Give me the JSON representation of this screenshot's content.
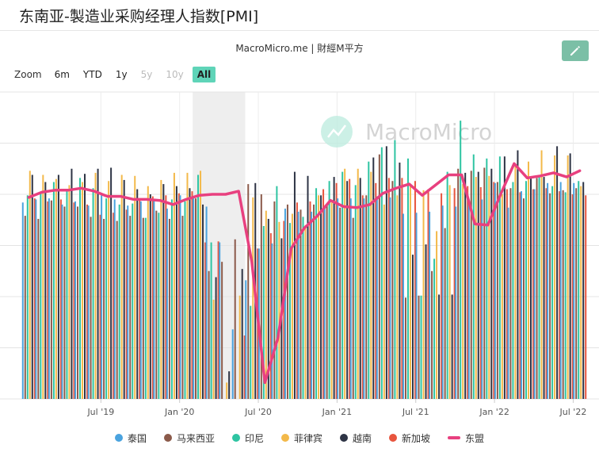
{
  "page": {
    "title": "东南亚-製造业采购经理人指数[PMI]"
  },
  "chart_header": {
    "source": "MacroMicro.me | 財經M平方",
    "watermark": "MacroMicro"
  },
  "zoom": {
    "label": "Zoom",
    "buttons": [
      {
        "label": "6m",
        "state": "normal"
      },
      {
        "label": "YTD",
        "state": "normal"
      },
      {
        "label": "1y",
        "state": "normal"
      },
      {
        "label": "5y",
        "state": "disabled"
      },
      {
        "label": "10y",
        "state": "disabled"
      },
      {
        "label": "All",
        "state": "active"
      }
    ]
  },
  "chart_data": {
    "type": "bar",
    "title": "",
    "xlabel": "",
    "ylabel": "",
    "ylim": [
      30,
      60
    ],
    "x_start": "2019-01",
    "x_end": "2022-08",
    "x_ticks": [
      {
        "label": "Jul '19",
        "date": "2019-07"
      },
      {
        "label": "Jan '20",
        "date": "2020-01"
      },
      {
        "label": "Jul '20",
        "date": "2020-07"
      },
      {
        "label": "Jan '21",
        "date": "2021-01"
      },
      {
        "label": "Jul '21",
        "date": "2021-07"
      },
      {
        "label": "Jan '22",
        "date": "2022-01"
      },
      {
        "label": "Jul '22",
        "date": "2022-07"
      }
    ],
    "recession_band": [
      "2020-02",
      "2020-06"
    ],
    "grid": true,
    "legend_position": "bottom",
    "months": [
      "2019-01",
      "2019-02",
      "2019-03",
      "2019-04",
      "2019-05",
      "2019-06",
      "2019-07",
      "2019-08",
      "2019-09",
      "2019-10",
      "2019-11",
      "2019-12",
      "2020-01",
      "2020-02",
      "2020-03",
      "2020-04",
      "2020-05",
      "2020-06",
      "2020-07",
      "2020-08",
      "2020-09",
      "2020-10",
      "2020-11",
      "2020-12",
      "2021-01",
      "2021-02",
      "2021-03",
      "2021-04",
      "2021-05",
      "2021-06",
      "2021-07",
      "2021-08",
      "2021-09",
      "2021-10",
      "2021-11",
      "2021-12",
      "2022-01",
      "2022-02",
      "2022-03",
      "2022-04",
      "2022-05",
      "2022-06",
      "2022-07"
    ],
    "series": [
      {
        "name": "泰国",
        "type": "bar",
        "color": "#4aa3df",
        "values": [
          49.2,
          49.5,
          49.6,
          49.0,
          49.3,
          48.9,
          49.9,
          49.5,
          48.9,
          49.3,
          49.5,
          48.6,
          49.9,
          49.6,
          48.8,
          45.3,
          36.8,
          41.6,
          44.7,
          45.2,
          48.6,
          48.3,
          48.3,
          48.8,
          49.6,
          49.6,
          49.6,
          49.8,
          49.7,
          48.1,
          48.2,
          48.3,
          48.9,
          48.8,
          49.4,
          49.5,
          51.1,
          48.7,
          50.3,
          50.5,
          51.1,
          51.2,
          51.1
        ]
      },
      {
        "name": "马来西亚",
        "type": "bar",
        "color": "#8b5a4a",
        "values": [
          47.9,
          47.6,
          49.4,
          48.8,
          48.8,
          47.8,
          47.6,
          47.4,
          47.9,
          47.7,
          48.4,
          47.6,
          47.9,
          49.6,
          42.5,
          43.4,
          45.6,
          51.0,
          50.0,
          49.3,
          49.0,
          48.5,
          49.0,
          49.1,
          48.7,
          47.7,
          49.9,
          53.9,
          51.3,
          39.9,
          40.1,
          42.5,
          46.7,
          52.5,
          52.3,
          52.6,
          51.2,
          50.6,
          49.6,
          51.6,
          50.1,
          50.4,
          50.6
        ]
      },
      {
        "name": "印尼",
        "type": "bar",
        "color": "#2ec4a2",
        "values": [
          49.9,
          50.1,
          51.2,
          50.4,
          51.6,
          50.6,
          49.6,
          49.0,
          49.1,
          47.7,
          48.2,
          49.5,
          49.3,
          51.9,
          45.3,
          27.5,
          28.6,
          39.1,
          46.9,
          50.8,
          47.2,
          47.8,
          50.6,
          51.3,
          52.2,
          50.9,
          53.2,
          54.6,
          55.3,
          53.5,
          40.1,
          43.7,
          52.2,
          57.2,
          53.9,
          53.5,
          53.7,
          51.2,
          51.3,
          51.9,
          50.8,
          50.2,
          51.3
        ]
      },
      {
        "name": "菲律宾",
        "type": "bar",
        "color": "#f3b94a",
        "values": [
          52.3,
          51.9,
          51.5,
          50.9,
          51.2,
          52.1,
          51.3,
          51.9,
          51.8,
          50.8,
          51.4,
          52.1,
          52.1,
          52.3,
          39.7,
          31.6,
          40.1,
          49.7,
          48.4,
          47.3,
          48.1,
          47.0,
          49.9,
          49.2,
          52.5,
          52.5,
          52.2,
          49.0,
          49.9,
          50.8,
          50.4,
          46.4,
          50.9,
          51.0,
          51.7,
          51.8,
          50.0,
          52.8,
          53.2,
          54.3,
          53.8,
          53.8,
          50.8
        ]
      },
      {
        "name": "越南",
        "type": "bar",
        "color": "#2e3445",
        "values": [
          51.9,
          51.2,
          51.9,
          52.5,
          52.0,
          52.5,
          52.6,
          51.4,
          50.5,
          50.0,
          51.0,
          50.8,
          50.6,
          49.0,
          41.9,
          32.7,
          42.7,
          51.1,
          47.6,
          45.7,
          52.2,
          51.8,
          49.9,
          51.7,
          51.3,
          51.6,
          53.6,
          54.7,
          53.1,
          44.1,
          45.1,
          40.2,
          40.2,
          52.1,
          52.2,
          52.5,
          53.7,
          54.3,
          51.7,
          51.7,
          54.7,
          54.0,
          51.2
        ]
      },
      {
        "name": "新加坡",
        "type": "bar",
        "color": "#e8553e",
        "values": [
          49.6,
          49.3,
          49.5,
          49.2,
          49.0,
          48.0,
          48.2,
          48.5,
          49.5,
          49.8,
          49.9,
          50.1,
          50.3,
          45.3,
          45.4,
          28.1,
          36.2,
          44.7,
          46.2,
          47.4,
          49.2,
          49.3,
          50.5,
          51.1,
          51.5,
          49.9,
          51.1,
          51.6,
          51.6,
          51.3,
          50.5,
          50.1,
          50.6,
          50.8,
          50.7,
          51.2,
          50.5,
          50.2,
          50.5,
          50.6,
          50.3,
          50.0,
          49.9
        ]
      },
      {
        "name": "东盟",
        "type": "line",
        "color": "#e8407f",
        "values": [
          49.7,
          50.2,
          50.4,
          50.4,
          50.6,
          50.3,
          49.8,
          49.8,
          49.5,
          49.5,
          49.4,
          49.0,
          49.5,
          49.9,
          50.0,
          50.0,
          50.3,
          43.4,
          31.6,
          36.0,
          44.7,
          46.7,
          47.9,
          49.4,
          48.8,
          48.7,
          49.0,
          50.1,
          50.6,
          51.0,
          49.9,
          50.9,
          51.9,
          51.9,
          47.1,
          47.0,
          50.1,
          53.0,
          51.6,
          51.8,
          52.1,
          51.7,
          52.3
        ]
      }
    ]
  },
  "legend": [
    {
      "label": "泰国",
      "color": "#4aa3df",
      "shape": "dot"
    },
    {
      "label": "马来西亚",
      "color": "#8b5a4a",
      "shape": "dot"
    },
    {
      "label": "印尼",
      "color": "#2ec4a2",
      "shape": "dot"
    },
    {
      "label": "菲律宾",
      "color": "#f3b94a",
      "shape": "dot"
    },
    {
      "label": "越南",
      "color": "#2e3445",
      "shape": "dot"
    },
    {
      "label": "新加坡",
      "color": "#e8553e",
      "shape": "dot"
    },
    {
      "label": "东盟",
      "color": "#e8407f",
      "shape": "line"
    }
  ]
}
